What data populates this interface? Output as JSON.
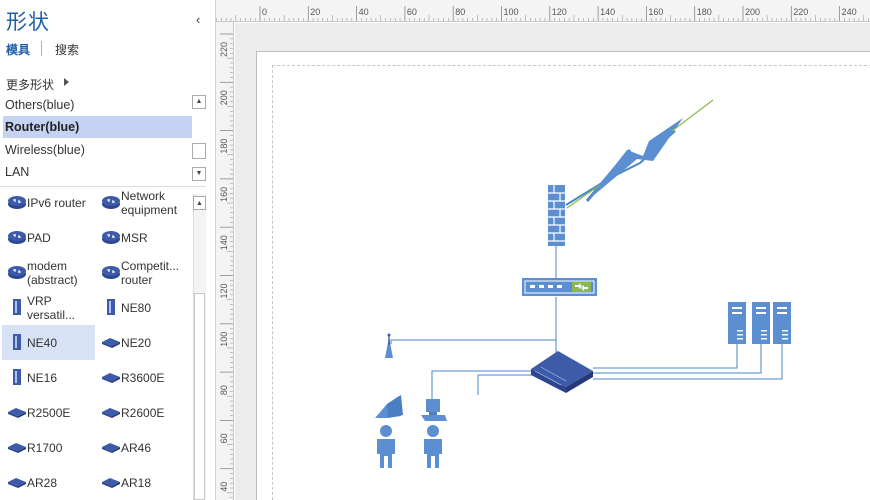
{
  "pane": {
    "title": "形状",
    "collapse_glyph": "‹",
    "tabs": [
      {
        "label": "模具",
        "active": true
      },
      {
        "label": "搜索",
        "active": false
      }
    ],
    "more_shapes": "更多形状",
    "stencils": [
      {
        "label": "Others(blue)",
        "selected": false
      },
      {
        "label": "Router(blue)",
        "selected": true
      },
      {
        "label": "Wireless(blue)",
        "selected": false
      },
      {
        "label": "LAN",
        "selected": false
      }
    ],
    "shapes": [
      {
        "label": "IPv6 router",
        "icon": "ipv6-router-icon",
        "selected": false
      },
      {
        "label": "Network equipment",
        "icon": "network-equipment-icon",
        "selected": false
      },
      {
        "label": "PAD",
        "icon": "pad-icon",
        "selected": false
      },
      {
        "label": "MSR",
        "icon": "msr-icon",
        "selected": false
      },
      {
        "label": "modem (abstract)",
        "icon": "modem-icon",
        "selected": false
      },
      {
        "label": "Competit... router",
        "icon": "competitor-router-icon",
        "selected": false
      },
      {
        "label": "VRP versatil...",
        "icon": "vrp-icon",
        "selected": false
      },
      {
        "label": "NE80",
        "icon": "ne80-icon",
        "selected": false
      },
      {
        "label": "NE40",
        "icon": "ne40-icon",
        "selected": true
      },
      {
        "label": "NE20",
        "icon": "ne20-icon",
        "selected": false
      },
      {
        "label": "NE16",
        "icon": "ne16-icon",
        "selected": false
      },
      {
        "label": "R3600E",
        "icon": "r3600e-icon",
        "selected": false
      },
      {
        "label": "R2500E",
        "icon": "r2500e-icon",
        "selected": false
      },
      {
        "label": "R2600E",
        "icon": "r2600e-icon",
        "selected": false
      },
      {
        "label": "R1700",
        "icon": "r1700-icon",
        "selected": false
      },
      {
        "label": "AR46",
        "icon": "ar46-icon",
        "selected": false
      },
      {
        "label": "AR28",
        "icon": "ar28-icon",
        "selected": false
      },
      {
        "label": "AR18",
        "icon": "ar18-icon",
        "selected": false
      }
    ]
  },
  "ruler": {
    "top_ticks": [
      "0",
      "20",
      "40",
      "60",
      "80",
      "100",
      "120",
      "140",
      "160",
      "180",
      "200",
      "220",
      "240"
    ],
    "left_ticks": [
      "220",
      "200",
      "180",
      "160",
      "140",
      "120",
      "100",
      "80",
      "60",
      "40"
    ]
  },
  "colors": {
    "accent": "#1f5fa8",
    "selection": "#c5d3f2",
    "shape_blue": "#5b8fd1",
    "router_blue": "#3d5ba8",
    "line_blue": "#4a86c8",
    "lightning_green": "#8ab84a"
  }
}
